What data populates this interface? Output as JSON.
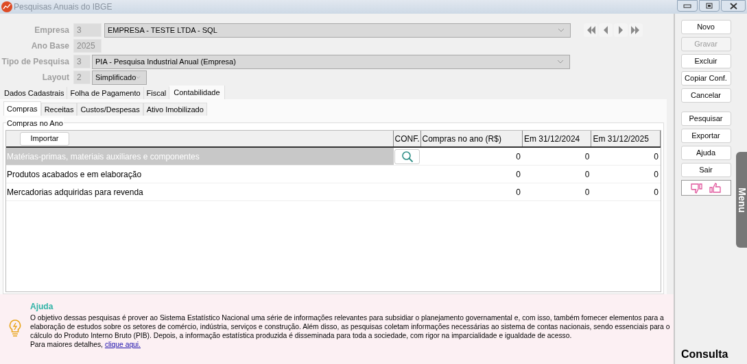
{
  "window": {
    "title": "Pesquisas Anuais do IBGE"
  },
  "form": {
    "empresa": {
      "label": "Empresa",
      "code": "3",
      "value": "EMPRESA - TESTE LTDA - SQL"
    },
    "ano_base": {
      "label": "Ano Base",
      "value": "2025"
    },
    "tipo": {
      "label": "Tipo de Pesquisa",
      "code": "3",
      "value": "PIA - Pesquisa Industrial Anual (Empresa)"
    },
    "layout": {
      "label": "Layout",
      "code": "2",
      "value": "Simplificado"
    }
  },
  "tabs": [
    {
      "label": "Dados Cadastrais",
      "selected": false
    },
    {
      "label": "Folha de Pagamento",
      "selected": false
    },
    {
      "label": "Fiscal",
      "selected": false
    },
    {
      "label": "Contabilidade",
      "selected": true
    }
  ],
  "subtabs": [
    {
      "label": "Compras",
      "selected": true
    },
    {
      "label": "Receitas",
      "selected": false
    },
    {
      "label": "Custos/Despesas",
      "selected": false
    },
    {
      "label": "Ativo Imobilizado",
      "selected": false
    }
  ],
  "group": {
    "title": "Compras no Ano",
    "import_button": "Importar",
    "columns": [
      "CONF.",
      "Compras no ano (R$)",
      "Em 31/12/2024",
      "Em 31/12/2025"
    ],
    "rows": [
      {
        "name": "Matérias-primas, materiais auxiliares e componentes",
        "selected": true,
        "values": [
          "0",
          "0",
          "0"
        ]
      },
      {
        "name": "Produtos acabados e em elaboração",
        "selected": false,
        "values": [
          "0",
          "0",
          "0"
        ]
      },
      {
        "name": "Mercadorias adquiridas para revenda",
        "selected": false,
        "values": [
          "0",
          "0",
          "0"
        ]
      }
    ]
  },
  "actions": [
    {
      "label": "Novo",
      "disabled": false
    },
    {
      "label": "Gravar",
      "disabled": true
    },
    {
      "label": "Excluir",
      "disabled": false
    },
    {
      "label": "Copiar Conf.",
      "disabled": false
    },
    {
      "label": "Cancelar",
      "disabled": false
    }
  ],
  "actions2": [
    {
      "label": "Pesquisar",
      "disabled": false
    },
    {
      "label": "Exportar",
      "disabled": false
    },
    {
      "label": "Ajuda",
      "disabled": false
    },
    {
      "label": "Sair",
      "disabled": false
    }
  ],
  "menu_tab": "Menu",
  "help": {
    "title": "Ajuda",
    "text": "O objetivo dessas pesquisas é prover ao Sistema Estatístico Nacional uma série de informações relevantes para subsidiar o planejamento governamental e, com isso, também fornecer elementos para a elaboração de estudos sobre os setores de comércio, indústria, serviços e construção. Além disso, as pesquisas coletam informações necessárias ao sistema de contas nacionais, sendo essenciais para o cálculo do Produto Interno Bruto (PIB). Depois, a informação estatística produzida é disseminada para toda a sociedade, com rigor na imparcialidade e igualdade de acesso.",
    "more": "Para maiores detalhes,",
    "link": "clique aqui."
  },
  "mode": "Consulta"
}
